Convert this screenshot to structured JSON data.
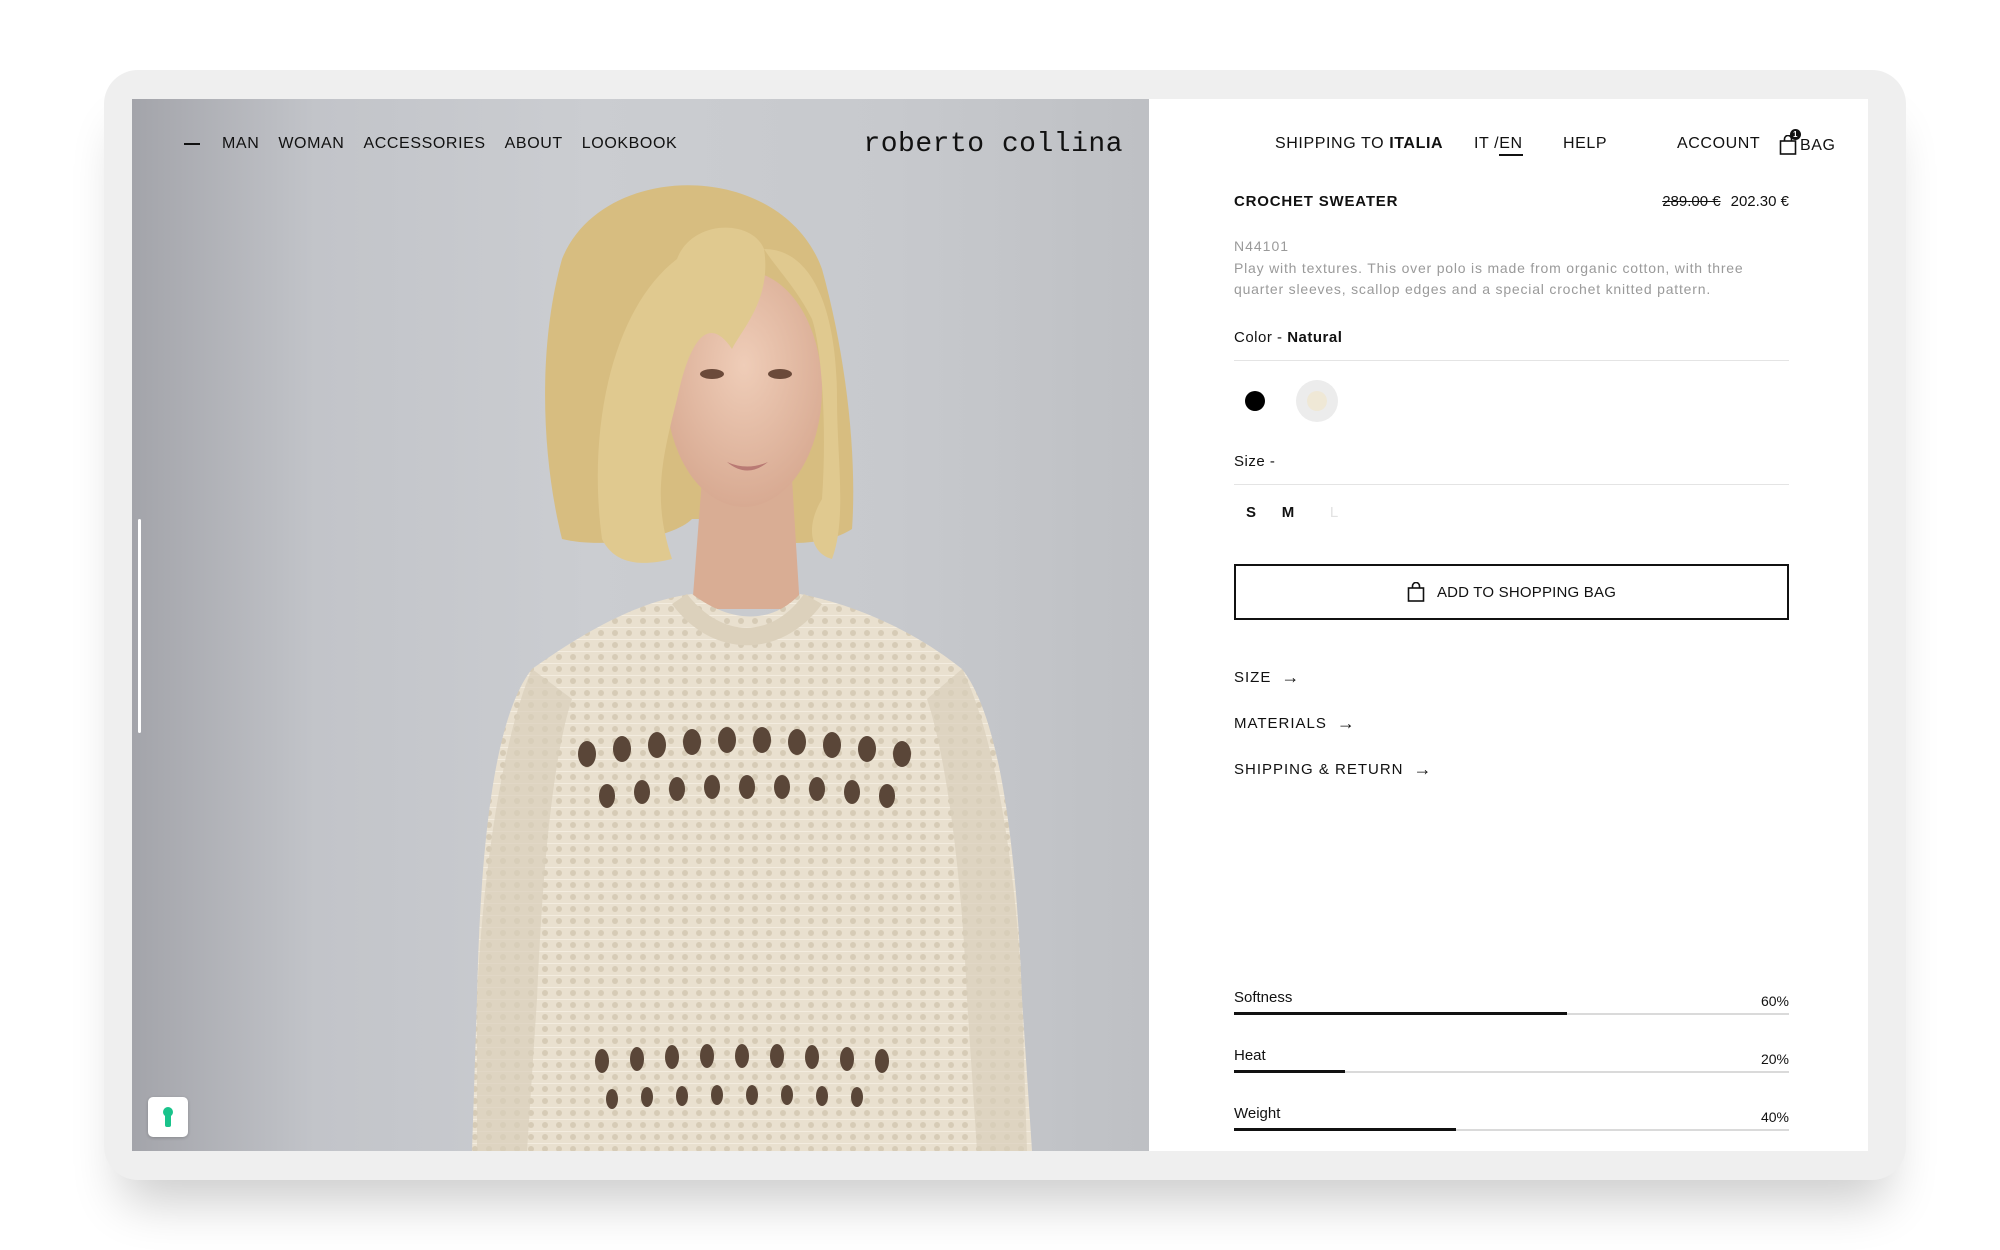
{
  "nav": {
    "items": [
      "MAN",
      "WOMAN",
      "ACCESSORIES",
      "ABOUT",
      "LOOKBOOK"
    ]
  },
  "brand": "roberto collina",
  "topnav": {
    "shipping_prefix": "SHIPPING TO",
    "shipping_country": "ITALIA",
    "lang_it": "IT /",
    "lang_en": "EN",
    "help": "HELP",
    "account": "ACCOUNT",
    "bag": "BAG",
    "bag_count": "1"
  },
  "product": {
    "title": "CROCHET SWEATER",
    "old_price": "289.00 €",
    "price": "202.30 €",
    "code": "N44101",
    "description": "Play with textures. This over polo is made from organic cotton, with three quarter sleeves, scallop edges and a special crochet knitted pattern.",
    "color_label": "Color -",
    "color_value": "Natural",
    "colors": [
      {
        "name": "black",
        "hex": "#000000"
      },
      {
        "name": "natural",
        "hex": "#efe8d6",
        "selected": true
      }
    ],
    "size_label": "Size -",
    "sizes": [
      {
        "label": "S",
        "available": true
      },
      {
        "label": "M",
        "available": true
      },
      {
        "label": "L",
        "available": false
      }
    ],
    "add_button": "ADD TO SHOPPING BAG"
  },
  "links": {
    "size": "SIZE",
    "materials": "MATERIALS",
    "shipping": "SHIPPING & RETURN"
  },
  "attributes": [
    {
      "label": "Softness",
      "value": "60%",
      "fraction": 0.6
    },
    {
      "label": "Heat",
      "value": "20%",
      "fraction": 0.2
    },
    {
      "label": "Weight",
      "value": "40%",
      "fraction": 0.4
    }
  ]
}
